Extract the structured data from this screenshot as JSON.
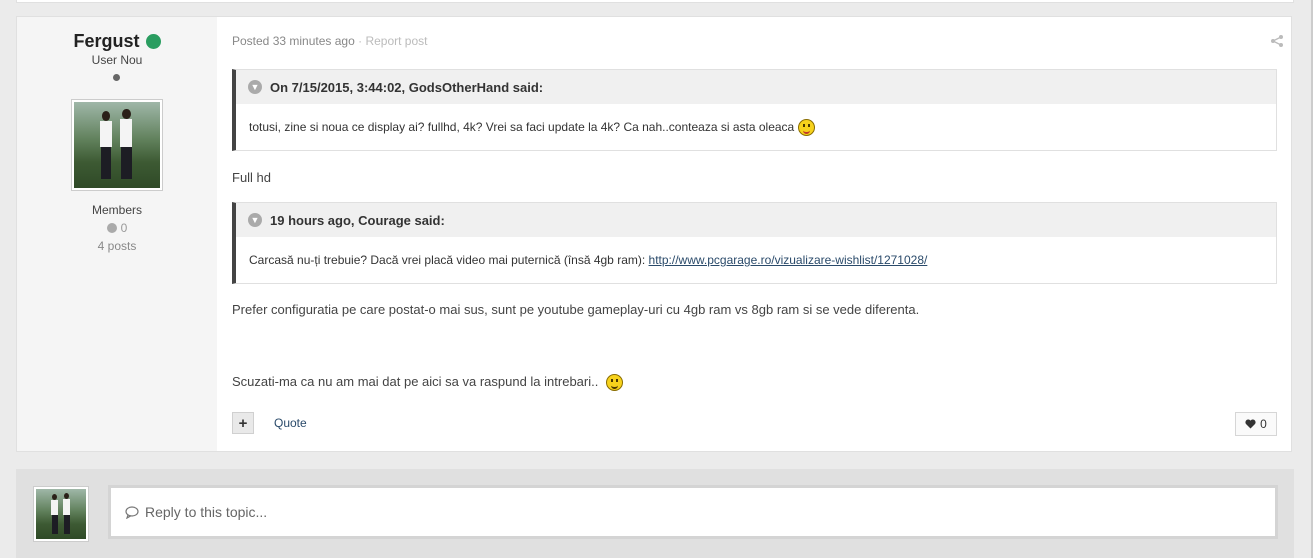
{
  "author": {
    "name": "Fergust",
    "title": "User Nou",
    "group": "Members",
    "reputation": "0",
    "posts": "4 posts"
  },
  "post": {
    "posted": "Posted 33 minutes ago",
    "separator": "·",
    "report": "Report post",
    "quotes": [
      {
        "header": "On 7/15/2015, 3:44:02, GodsOtherHand said:",
        "body": "totusi, zine si noua ce display ai? fullhd, 4k? Vrei sa faci update la 4k? Ca nah..conteaza si asta oleaca"
      },
      {
        "header": "19 hours ago, Courage said:",
        "body": "Carcasă nu-ți trebuie? Dacă vrei placă video mai puternică (însă 4gb ram):",
        "link": "http://www.pcgarage.ro/vizualizare-wishlist/1271028/"
      }
    ],
    "reply1": "Full hd",
    "reply2": "Prefer configuratia pe care postat-o mai sus, sunt pe youtube gameplay-uri cu 4gb ram vs 8gb ram si se vede diferenta.",
    "reply3": "Scuzati-ma ca nu am mai dat pe aici sa va raspund la intrebari..",
    "add_label": "+",
    "quote_label": "Quote",
    "reaction_count": "0"
  },
  "reply": {
    "placeholder": "Reply to this topic..."
  },
  "icons": {
    "heart": "heart-icon",
    "comment": "comment-icon",
    "share": "share-icon",
    "toggle": "chevron-down-icon"
  },
  "colors": {
    "online": "#2a9d60",
    "link": "#2a4a6a",
    "quote_border": "#444444"
  }
}
